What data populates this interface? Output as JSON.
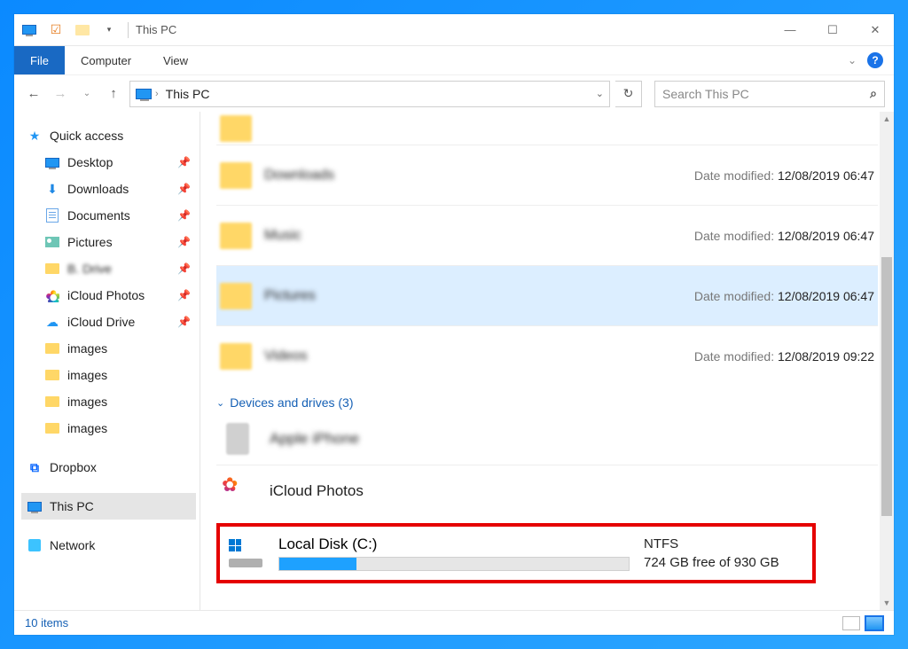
{
  "titlebar": {
    "title": "This PC"
  },
  "ribbon": {
    "file": "File",
    "computer": "Computer",
    "view": "View"
  },
  "address": {
    "crumb": "This PC",
    "search_placeholder": "Search This PC"
  },
  "sidebar": {
    "quick_access": "Quick access",
    "items": [
      {
        "label": "Desktop",
        "pin": true
      },
      {
        "label": "Downloads",
        "pin": true
      },
      {
        "label": "Documents",
        "pin": true
      },
      {
        "label": "Pictures",
        "pin": true
      },
      {
        "label": "B. Drive",
        "pin": true,
        "blur": true
      },
      {
        "label": "iCloud Photos",
        "pin": true
      },
      {
        "label": "iCloud Drive",
        "pin": true
      },
      {
        "label": "images"
      },
      {
        "label": "images"
      },
      {
        "label": "images"
      },
      {
        "label": "images"
      }
    ],
    "dropbox": "Dropbox",
    "this_pc": "This PC",
    "network": "Network"
  },
  "folders": [
    {
      "name": "Downloads",
      "date_label": "Date modified:",
      "date": "12/08/2019 06:47"
    },
    {
      "name": "Music",
      "date_label": "Date modified:",
      "date": "12/08/2019 06:47"
    },
    {
      "name": "Pictures",
      "date_label": "Date modified:",
      "date": "12/08/2019 06:47",
      "selected": true
    },
    {
      "name": "Videos",
      "date_label": "Date modified:",
      "date": "12/08/2019 09:22"
    }
  ],
  "devices_header": "Devices and drives (3)",
  "devices": {
    "phone": "Apple iPhone",
    "icloud": "iCloud Photos"
  },
  "disk": {
    "name": "Local Disk (C:)",
    "fs": "NTFS",
    "free": "724 GB free of 930 GB"
  },
  "status": {
    "count": "10 items"
  }
}
